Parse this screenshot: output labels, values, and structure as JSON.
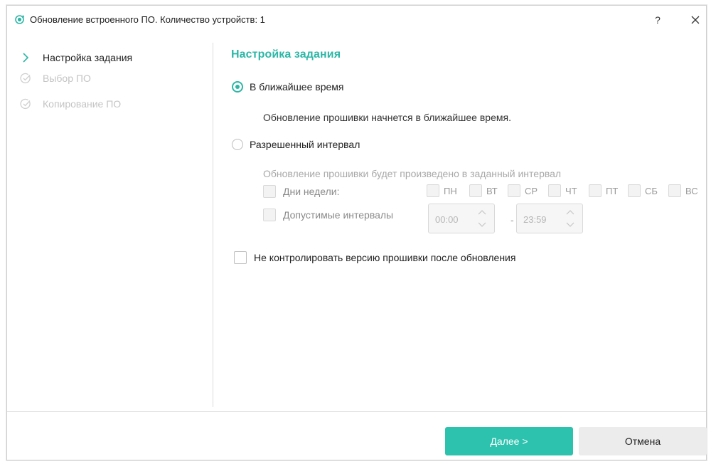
{
  "window": {
    "title": "Обновление встроенного ПО. Количество устройств: 1",
    "help_label": "?"
  },
  "sidebar": {
    "steps": [
      {
        "label": "Настройка задания",
        "state": "active"
      },
      {
        "label": "Выбор ПО",
        "state": "pending"
      },
      {
        "label": "Копирование ПО",
        "state": "pending"
      }
    ]
  },
  "content": {
    "section_title": "Настройка задания",
    "option_asap": {
      "label": "В ближайшее время",
      "checked": true,
      "description": "Обновление прошивки начнется в ближайшее время."
    },
    "option_interval": {
      "label": "Разрешенный интервал",
      "checked": false,
      "description": "Обновление прошивки будет произведено в заданный интервал"
    },
    "weekdays": {
      "label": "Дни недели:",
      "days": [
        "ПН",
        "ВТ",
        "СР",
        "ЧТ",
        "ПТ",
        "СБ",
        "ВС"
      ]
    },
    "intervals": {
      "label": "Допустимые интервалы",
      "start": "00:00",
      "separator": "-",
      "end": "23:59"
    },
    "no_version_check": {
      "label": "Не контролировать версию прошивки после обновления",
      "checked": false
    }
  },
  "footer": {
    "next_label": "Далее >",
    "cancel_label": "Отмена"
  },
  "colors": {
    "accent": "#2db6a6",
    "primary_button": "#2cc2ae"
  }
}
